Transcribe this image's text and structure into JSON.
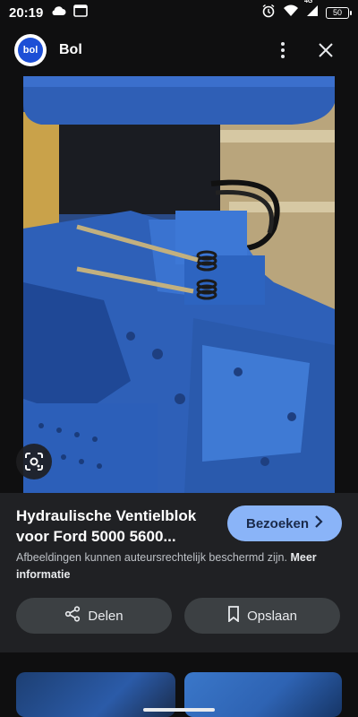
{
  "status": {
    "time": "20:19",
    "battery": "50",
    "network": "4G"
  },
  "header": {
    "logo_text": "bol",
    "site_name": "Bol",
    "more_icon": "vertical-dots-icon",
    "close_icon": "close-icon"
  },
  "image": {
    "subject": "blue-tractor-hydraulic-valve-block",
    "lens_icon": "google-lens-icon"
  },
  "result": {
    "title_line1": "Hydraulische Ventielblok",
    "title_line2": "voor Ford 5000 5600...",
    "visit_label": "Bezoeken",
    "notice_text": "Afbeeldingen kunnen auteursrechtelijk beschermd zijn.",
    "notice_more": "Meer informatie",
    "share_label": "Delen",
    "save_label": "Opslaan"
  },
  "colors": {
    "accent": "#8ab4f8",
    "panel": "#202124",
    "button": "#3c4043",
    "brand": "#1d4fd6"
  }
}
